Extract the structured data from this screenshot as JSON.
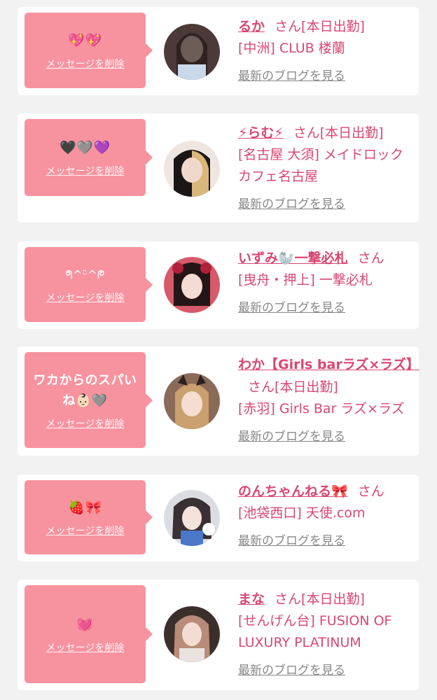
{
  "colors": {
    "accent": "#d94772",
    "bubble": "#f7939f",
    "muted": "#888888"
  },
  "delete_label": "メッセージを削除",
  "blog_label": "最新のブログを見る",
  "san_label": "さん",
  "cards": [
    {
      "message": "💖💖",
      "name": "るか",
      "status": "[本日出勤]",
      "shop": "[中洲] CLUB 楼蘭"
    },
    {
      "message": "🖤🩶💜",
      "name": "⚡らむ⚡",
      "status": "[本日出勤]",
      "shop": "[名古屋 大須] メイドロックカフェ名古屋"
    },
    {
      "message": "ᖗ^ᵕ̈^ᖘ",
      "name": "いずみ🦭一撃必札",
      "status": "",
      "shop": "[曳舟・押上] 一撃必札"
    },
    {
      "message": "ワカからのスパいね👶🏻🩶",
      "name": "わか【Girls barラズ×ラズ】",
      "status": "[本日出勤]",
      "shop": "[赤羽] Girls Bar ラズ×ラズ"
    },
    {
      "message": "🍓🎀",
      "name": "のんちゃんねる🎀",
      "status": "",
      "shop": "[池袋西口] 天使.com"
    },
    {
      "message": "💓",
      "name": "まな",
      "status": "[本日出勤]",
      "shop": "[せんげん台] FUSION OF LUXURY PLATINUM"
    }
  ]
}
